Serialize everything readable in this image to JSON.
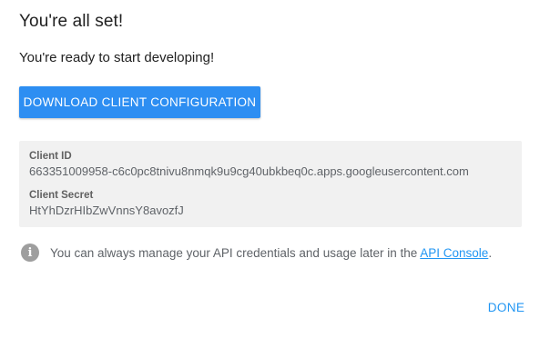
{
  "dialog": {
    "title": "You're all set!",
    "subtitle": "You're ready to start developing!",
    "download_label": "DOWNLOAD CLIENT CONFIGURATION",
    "credentials": {
      "client_id_label": "Client ID",
      "client_id_value": "663351009958-c6c0pc8tnivu8nmqk9u9cg40ubkbeq0c.apps.googleusercontent.com",
      "client_secret_label": "Client Secret",
      "client_secret_value": "HtYhDzrHIbZwVnnsY8avozfJ"
    },
    "info": {
      "icon": "info-icon",
      "text": "You can always manage your API credentials and usage later in the ",
      "link_text": "API Console",
      "text_after": "."
    },
    "done_label": "DONE"
  },
  "colors": {
    "primary": "#2d8ef2",
    "link": "#2196f3",
    "panel_bg": "#f1f1f1",
    "muted_text": "#5f6368"
  }
}
